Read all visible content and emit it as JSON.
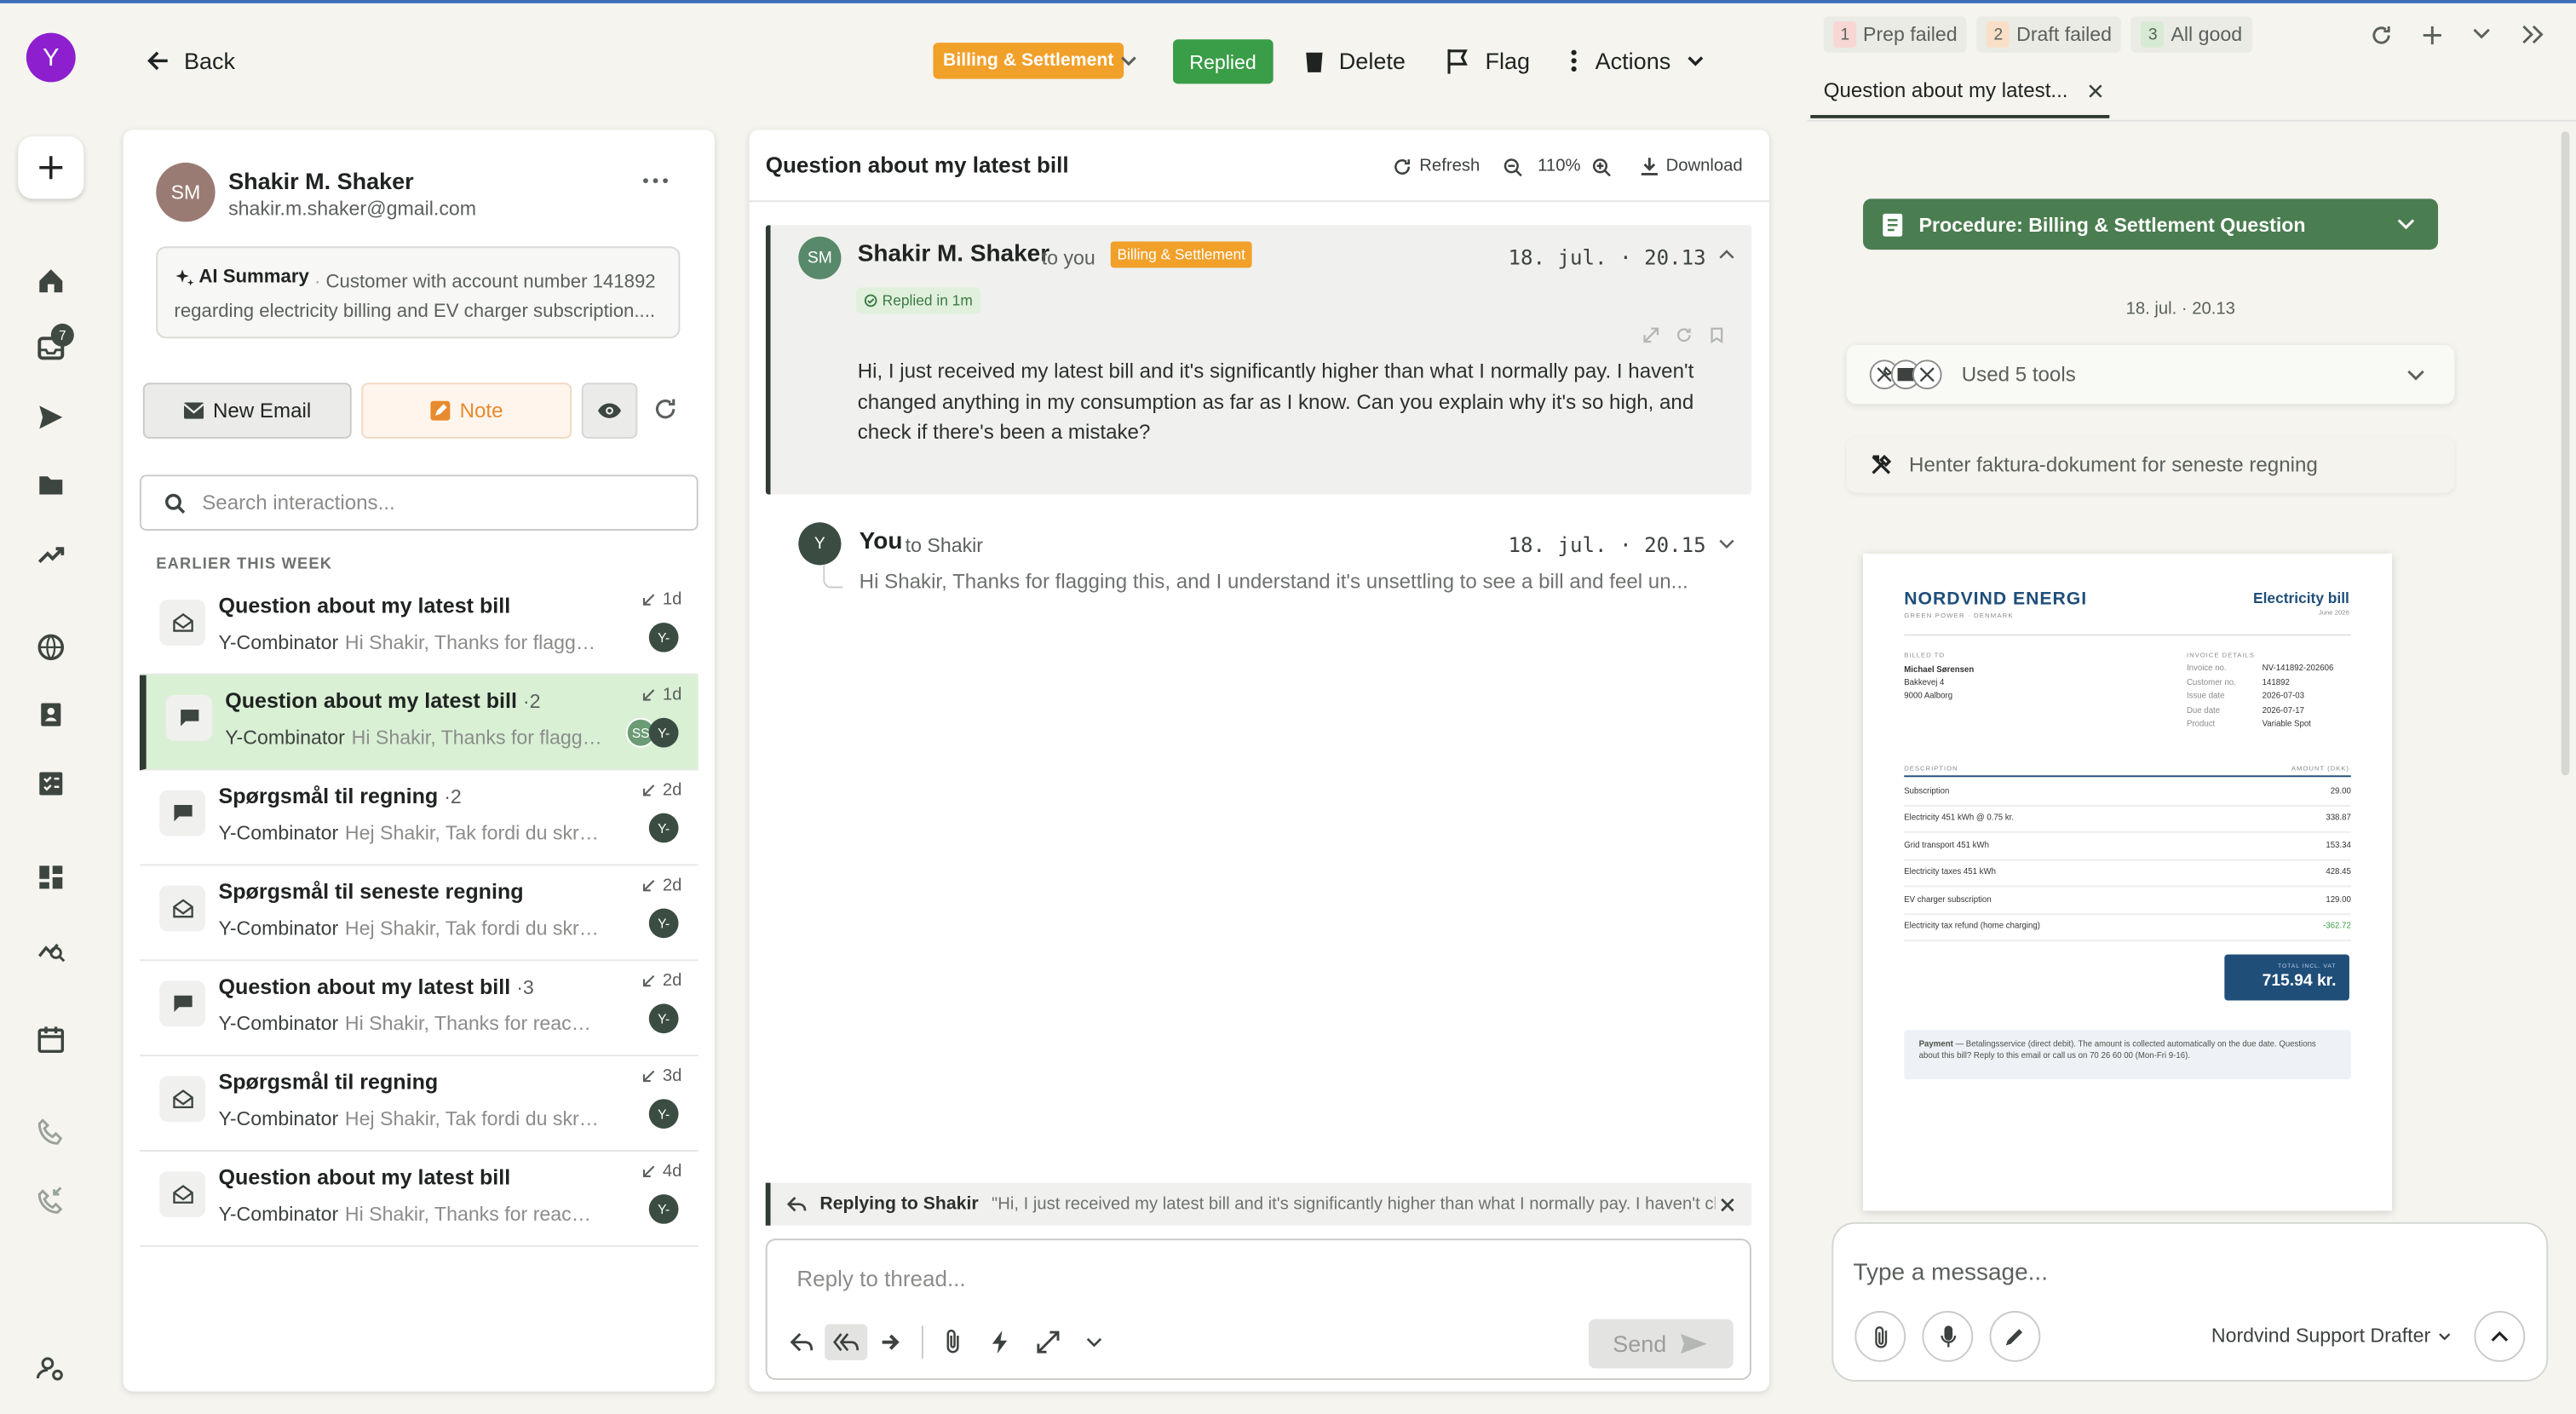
{
  "nav": {
    "user_initial": "Y",
    "inbox_badge": "7"
  },
  "top": {
    "back": "Back",
    "category": "Billing & Settlement",
    "status": "Replied",
    "delete": "Delete",
    "flag": "Flag",
    "actions": "Actions"
  },
  "contact": {
    "initials": "SM",
    "name": "Shakir M. Shaker",
    "email": "shakir.m.shaker@gmail.com",
    "ai_label": "AI Summary",
    "ai_text": "Customer with account number 141892 regarding electricity billing and EV charger subscription...."
  },
  "left_actions": {
    "new_email": "New Email",
    "note": "Note"
  },
  "search": {
    "placeholder": "Search interactions..."
  },
  "section_label": "EARLIER THIS WEEK",
  "threads": [
    {
      "title": "Question about my latest bill",
      "count": "",
      "sender": "Y-Combinator",
      "snippet": "Hi Shakir, Thanks for flagging this, and I understand",
      "age": "1d",
      "avatar": "Y-",
      "icon": "email"
    },
    {
      "title": "Question about my latest bill",
      "count": "·2",
      "sender": "Y-Combinator",
      "snippet": "Hi Shakir, Thanks for flagging this, and I understand",
      "age": "1d",
      "avatar": "Y-",
      "avatar2": "SS",
      "icon": "chat"
    },
    {
      "title": "Spørgsmål til regning",
      "count": "·2",
      "sender": "Y-Combinator",
      "snippet": "Hej Shakir, Tak fordi du skrev til os",
      "age": "2d",
      "avatar": "Y-",
      "icon": "chat"
    },
    {
      "title": "Spørgsmål til seneste regning",
      "count": "",
      "sender": "Y-Combinator",
      "snippet": "Hej Shakir, Tak fordi du skrev til os",
      "age": "2d",
      "avatar": "Y-",
      "icon": "email"
    },
    {
      "title": "Question about my latest bill",
      "count": "·3",
      "sender": "Y-Combinator",
      "snippet": "Hi Shakir, Thanks for reaching out",
      "age": "2d",
      "avatar": "Y-",
      "icon": "chat"
    },
    {
      "title": "Spørgsmål til regning",
      "count": "",
      "sender": "Y-Combinator",
      "snippet": "Hej Shakir, Tak fordi du skrev til os",
      "age": "3d",
      "avatar": "Y-",
      "icon": "email"
    },
    {
      "title": "Question about my latest bill",
      "count": "",
      "sender": "Y-Combinator",
      "snippet": "Hi Shakir, Thanks for reaching out",
      "age": "4d",
      "avatar": "Y-",
      "icon": "email"
    }
  ],
  "thread": {
    "subject": "Question about my latest bill",
    "refresh": "Refresh",
    "zoom": "110%",
    "download": "Download",
    "msg1": {
      "initials": "SM",
      "from": "Shakir M. Shaker",
      "to": "to you",
      "tag": "Billing & Settlement",
      "time": "18. jul. · 20.13",
      "replied": "Replied in 1m",
      "body": "Hi, I just received my latest bill and it's significantly higher than what I normally pay. I haven't changed anything in my consumption as far as I know. Can you explain why it's so high, and check if there's been a mistake?"
    },
    "msg2": {
      "initials": "Y",
      "from": "You",
      "to": "to Shakir",
      "time": "18. jul. · 20.15",
      "preview": "Hi Shakir, Thanks for flagging this, and I understand it's unsettling to see a bill and feel un..."
    },
    "replying_label": "Replying to Shakir",
    "replying_quote": "\"Hi, I just received my latest bill and it's significantly higher than what I normally pay. I haven't chang...",
    "reply_placeholder": "Reply to thread...",
    "send": "Send"
  },
  "right": {
    "chips": [
      {
        "n": "1",
        "label": "Prep failed",
        "color": "#f7d6d3"
      },
      {
        "n": "2",
        "label": "Draft failed",
        "color": "#f9dfc8"
      },
      {
        "n": "3",
        "label": "All good",
        "color": "#d7ead4"
      }
    ],
    "tab_title": "Question about my latest...",
    "procedure": "Procedure: Billing & Settlement Question",
    "timestamp": "18. jul. · 20.13",
    "tools_label": "Used 5 tools",
    "step": "Henter faktura-dokument for seneste regning",
    "message_placeholder": "Type a message...",
    "agent": "Nordvind Support Drafter"
  },
  "invoice": {
    "brand": "NORDVIND ENERGI",
    "tagline": "GREEN POWER · DENMARK",
    "doc_title": "Electricity bill",
    "period": "June 2026",
    "billed_to_label": "BILLED TO",
    "name": "Michael Sørensen",
    "addr1": "Bakkevej 4",
    "addr2": "9000 Aalborg",
    "details_label": "INVOICE DETAILS",
    "details": [
      {
        "k": "Invoice no.",
        "v": "NV-141892-202606"
      },
      {
        "k": "Customer no.",
        "v": "141892"
      },
      {
        "k": "Issue date",
        "v": "2026-07-03"
      },
      {
        "k": "Due date",
        "v": "2026-07-17"
      },
      {
        "k": "Product",
        "v": "Variable Spot"
      }
    ],
    "desc_h": "DESCRIPTION",
    "amt_h": "AMOUNT (DKK)",
    "lines": [
      {
        "d": "Subscription",
        "a": "29.00"
      },
      {
        "d": "Electricity 451 kWh @ 0.75 kr.",
        "a": "338.87"
      },
      {
        "d": "Grid transport 451 kWh",
        "a": "153.34"
      },
      {
        "d": "Electricity taxes 451 kWh",
        "a": "428.45"
      },
      {
        "d": "EV charger subscription",
        "a": "129.00"
      },
      {
        "d": "Electricity tax refund (home charging)",
        "a": "-362.72"
      }
    ],
    "total_label": "TOTAL INCL. VAT",
    "total": "715.94 kr.",
    "payment_label": "Payment",
    "payment_text": " — Betalingsservice (direct debit). The amount is collected automatically on the due date. Questions about this bill? Reply to this email or call us on 70 26 60 00 (Mon-Fri 9-16)."
  }
}
